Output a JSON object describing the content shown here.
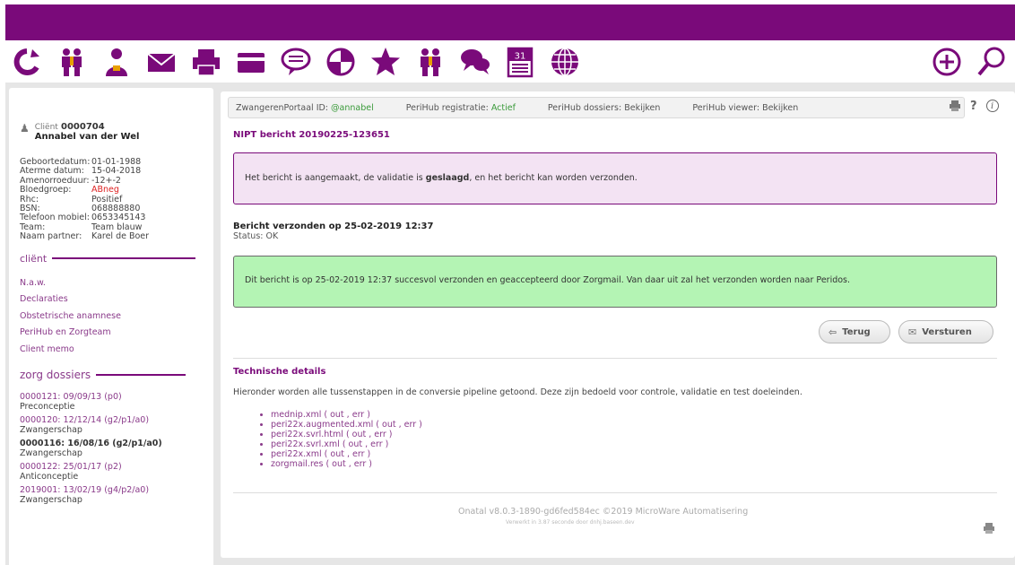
{
  "icons": [
    "refresh-icon",
    "couple-icon",
    "person-icon",
    "mail-icon",
    "printer-icon",
    "card-icon",
    "speech-bubble-icon",
    "pie-chart-icon",
    "star-icon",
    "group-icon",
    "chat-icon",
    "calendar-icon",
    "globe-icon",
    "plus-circle-icon",
    "search-icon"
  ],
  "calendar_day": "31",
  "client": {
    "label": "Cliënt",
    "number": "0000704",
    "name": "Annabel van der Wel",
    "fields": [
      {
        "label": "Geboortedatum:",
        "value": "01-01-1988"
      },
      {
        "label": "Aterme datum:",
        "value": "15-04-2018"
      },
      {
        "label": "Amenorroeduur:",
        "value": "-12+-2"
      },
      {
        "label": "Bloedgroep:",
        "value": "ABneg"
      },
      {
        "label": "Rhc:",
        "value": "Positief"
      },
      {
        "label": "BSN:",
        "value": "068888880"
      },
      {
        "label": "Telefoon mobiel:",
        "value": "0653345143"
      },
      {
        "label": "Team:",
        "value": "Team blauw"
      },
      {
        "label": "Naam partner:",
        "value": "Karel de Boer"
      }
    ]
  },
  "sidebar": {
    "client_section": "cliënt",
    "client_links": [
      "N.a.w.",
      "Declaraties",
      "Obstetrische anamnese",
      "PeriHub en Zorgteam",
      "Client memo"
    ],
    "zorg_section": "zorg dossiers",
    "dossiers": [
      {
        "link": "0000121: 09/09/13 (p0)",
        "type": "Preconceptie"
      },
      {
        "link": "0000120: 12/12/14 (g2/p1/a0)",
        "type": "Zwangerschap"
      },
      {
        "link": "0000116: 16/08/16 (g2/p1/a0)",
        "type": "Zwangerschap"
      },
      {
        "link": "0000122: 25/01/17 (p2)",
        "type": "Anticonceptie"
      },
      {
        "link": "2019001: 13/02/19 (g4/p2/a0)",
        "type": "Zwangerschap"
      }
    ]
  },
  "topstrip": {
    "portal_label": "ZwangerenPortaal ID:",
    "portal_value": "@annabel",
    "registratie_label": "PeriHub registratie:",
    "registratie_value": "Actief",
    "dossiers": "PeriHub dossiers: Bekijken",
    "viewer": "PeriHub viewer: Bekijken",
    "help": "?",
    "info": "i"
  },
  "message": {
    "title": "NIPT bericht 20190225-123651",
    "validation_pre": "Het bericht is aangemaakt, de validatie is ",
    "validation_bold": "geslaagd",
    "validation_post": ", en het bericht kan worden verzonden.",
    "sent_title": "Bericht verzonden op 25-02-2019 12:37",
    "sent_status": "Status: OK",
    "success": "Dit bericht is op 25-02-2019 12:37 succesvol verzonden en geaccepteerd door Zorgmail. Van daar uit zal het verzonden worden naar Peridos."
  },
  "buttons": {
    "back": "Terug",
    "send": "Versturen"
  },
  "technical": {
    "title": "Technische details",
    "description": "Hieronder worden alle tussenstappen in de conversie pipeline getoond. Deze zijn bedoeld voor controle, validatie en test doeleinden.",
    "files": [
      "mednip.xml ( out , err )",
      "peri22x.augmented.xml ( out , err )",
      "peri22x.svrl.html ( out , err )",
      "peri22x.svrl.xml ( out , err )",
      "peri22x.xml ( out , err )",
      "zorgmail.res ( out , err )"
    ]
  },
  "footer": {
    "version": "Onatal v8.0.3-1890-gd6fed584ec ©2019 MicroWare Automatisering",
    "timing": "Verwerkt in 3.87 seconde door dnhj.baseen.dev"
  },
  "colors": {
    "brand": "#7a0a7a",
    "link": "#8a3a8a",
    "success_bg": "#b4f4b4",
    "info_bg": "#f3e3f3"
  }
}
